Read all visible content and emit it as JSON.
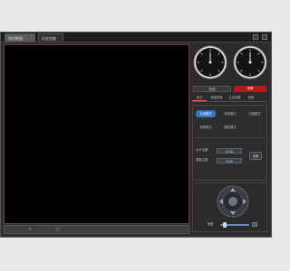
{
  "tabs": [
    {
      "label": "实时视频"
    },
    {
      "label": "历史回放"
    }
  ],
  "status": {
    "left_label": "在线",
    "badge_label": "报警",
    "badge_color": "#b01c1c"
  },
  "panel_tabs": [
    {
      "label": "模式"
    },
    {
      "label": "视频参数"
    },
    {
      "label": "云台设置"
    },
    {
      "label": "其他"
    }
  ],
  "modes": [
    {
      "label": "手动模式"
    },
    {
      "label": "巡航模式"
    },
    {
      "label": "扫描模式"
    },
    {
      "label": "预置模式"
    },
    {
      "label": "跟踪模式"
    }
  ],
  "fields": {
    "row1_label": "水平位置:",
    "row1_value": "0.00",
    "row2_label": "垂直位置:",
    "row2_value": "0.00",
    "set_label": "设置"
  },
  "ptz": {
    "speed_label": "速度",
    "speed_level": 0.1
  },
  "colors": {
    "accent": "#3b72c6",
    "alarm": "#b01c1c"
  }
}
